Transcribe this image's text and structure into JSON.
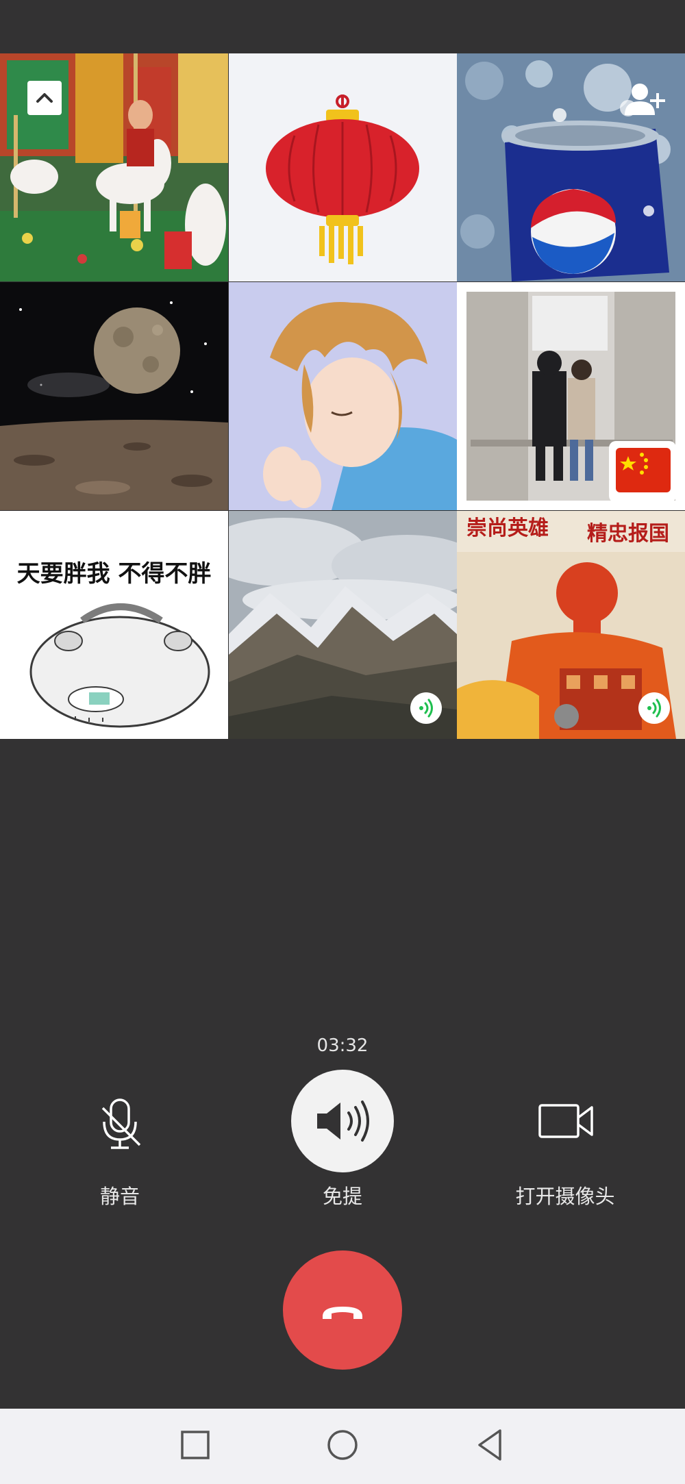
{
  "call": {
    "timer": "03:32",
    "status_color": "#1fbf4f"
  },
  "grid": {
    "participants": [
      {
        "avatar": "carousel-horse-photo",
        "speaking": false
      },
      {
        "avatar": "red-lantern-drawing",
        "speaking": false
      },
      {
        "avatar": "cola-can-in-ice-photo",
        "speaking": false
      },
      {
        "avatar": "moon-over-rocky-ground",
        "speaking": false
      },
      {
        "avatar": "sleeping-anime-boy",
        "speaking": false
      },
      {
        "avatar": "couple-in-warehouse-with-flag",
        "speaking": false
      },
      {
        "avatar": "hamster-meme",
        "speaking": false,
        "caption": "天要胖我 不得不胖"
      },
      {
        "avatar": "snowy-mountains",
        "speaking": true
      },
      {
        "avatar": "heroic-poster",
        "speaking": true,
        "caption_left": "崇尚英雄",
        "caption_right": "精忠报国"
      }
    ]
  },
  "controls": {
    "mute_label": "静音",
    "speaker_label": "免提",
    "camera_label": "打开摄像头"
  },
  "colors": {
    "background": "#333233",
    "hangup": "#e34b4b",
    "speaker_active": "#f2f2f2",
    "speaking_indicator": "#1fbf4f"
  }
}
